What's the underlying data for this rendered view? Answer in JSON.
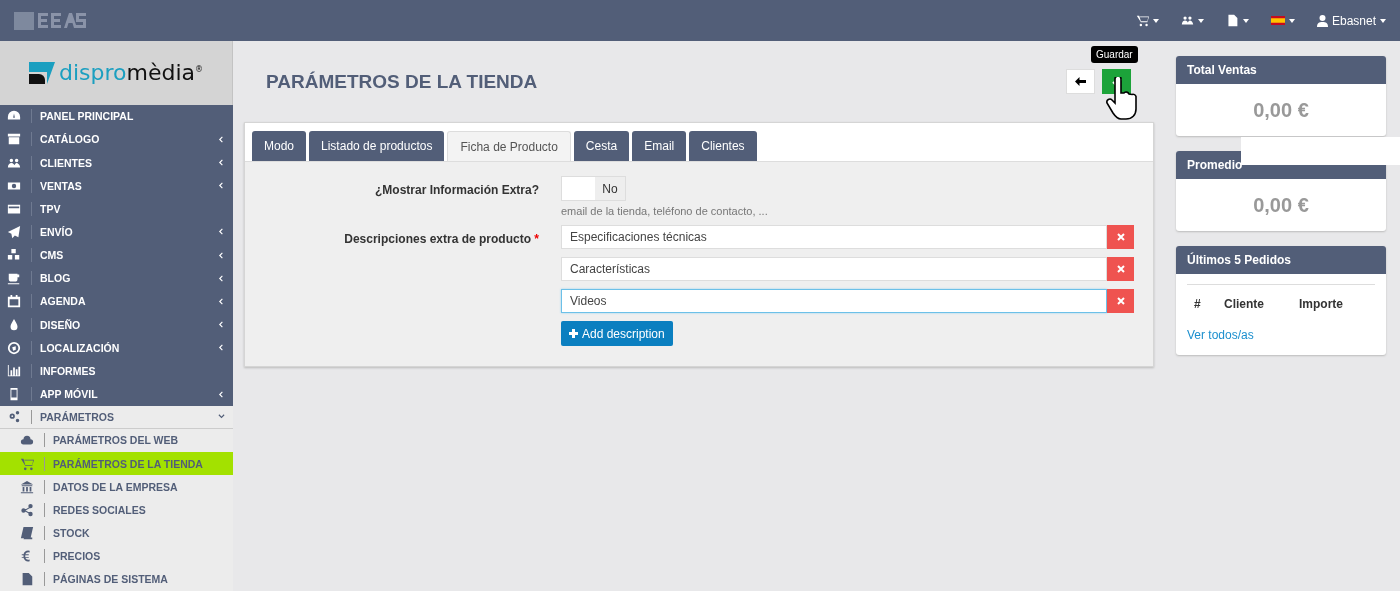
{
  "topbar": {
    "menus": [
      {
        "kind": "cart"
      },
      {
        "kind": "users"
      },
      {
        "kind": "list"
      },
      {
        "kind": "flag"
      },
      {
        "kind": "user",
        "label": "Ebasnet"
      }
    ]
  },
  "sidebar": {
    "brand": {
      "left": "dispro",
      "right": "mèdia",
      "mark": "®"
    },
    "items": [
      {
        "label": "PANEL PRINCIPAL",
        "submenu": false
      },
      {
        "label": "CATÁLOGO",
        "submenu": true
      },
      {
        "label": "CLIENTES",
        "submenu": true
      },
      {
        "label": "VENTAS",
        "submenu": true
      },
      {
        "label": "TPV",
        "submenu": false
      },
      {
        "label": "ENVÍO",
        "submenu": true
      },
      {
        "label": "CMS",
        "submenu": true
      },
      {
        "label": "BLOG",
        "submenu": true
      },
      {
        "label": "AGENDA",
        "submenu": true
      },
      {
        "label": "DISEÑO",
        "submenu": true
      },
      {
        "label": "LOCALIZACIÓN",
        "submenu": true
      },
      {
        "label": "INFORMES",
        "submenu": false
      },
      {
        "label": "APP MÓVIL",
        "submenu": true
      },
      {
        "label": "PARÁMETROS",
        "submenu": true,
        "expanded": true,
        "children": [
          {
            "label": "PARÁMETROS DEL WEB",
            "selected": false
          },
          {
            "label": "PARÁMETROS DE LA TIENDA",
            "selected": true
          },
          {
            "label": "DATOS DE LA EMPRESA",
            "selected": false
          },
          {
            "label": "REDES SOCIALES",
            "selected": false
          },
          {
            "label": "STOCK",
            "selected": false
          },
          {
            "label": "PRECIOS",
            "selected": false
          },
          {
            "label": "PÁGINAS DE SISTEMA",
            "selected": false
          }
        ]
      }
    ]
  },
  "page": {
    "title": "PARÁMETROS DE LA TIENDA",
    "tooltip": "Guardar"
  },
  "tabs": [
    {
      "label": "Modo",
      "selected": false
    },
    {
      "label": "Listado de productos",
      "selected": false
    },
    {
      "label": "Ficha de Producto",
      "selected": true
    },
    {
      "label": "Cesta",
      "selected": false
    },
    {
      "label": "Email",
      "selected": false
    },
    {
      "label": "Clientes",
      "selected": false
    }
  ],
  "form": {
    "show_extra": {
      "label": "¿Mostrar Información Extra?",
      "on": false,
      "value_label": "No",
      "help": "email de la tienda, teléfono de contacto, ..."
    },
    "descriptions": {
      "label": "Descripciones extra de producto",
      "required_mark": "*",
      "items": [
        {
          "value": "Especificaciones técnicas",
          "focused": false
        },
        {
          "value": "Características",
          "focused": false
        },
        {
          "value": "Videos",
          "focused": true
        }
      ],
      "add_button": "Add description"
    }
  },
  "widgets": [
    {
      "kind": "stat",
      "title": "Total Ventas",
      "value": "0,00 €"
    },
    {
      "kind": "stat",
      "title": "Promedio",
      "value": "0,00 €"
    },
    {
      "kind": "orders",
      "title": "Últimos 5 Pedidos",
      "columns": [
        "#",
        "Cliente",
        "Importe"
      ],
      "link": "Ver todos/as"
    }
  ]
}
